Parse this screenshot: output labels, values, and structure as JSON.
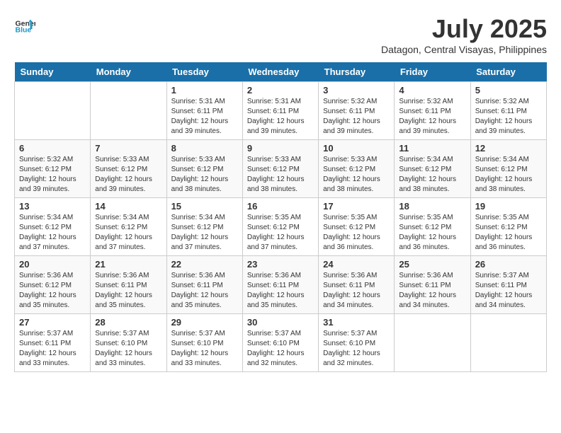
{
  "header": {
    "logo_line1": "General",
    "logo_line2": "Blue",
    "month_title": "July 2025",
    "location": "Datagon, Central Visayas, Philippines"
  },
  "days_of_week": [
    "Sunday",
    "Monday",
    "Tuesday",
    "Wednesday",
    "Thursday",
    "Friday",
    "Saturday"
  ],
  "weeks": [
    [
      {
        "day": "",
        "info": ""
      },
      {
        "day": "",
        "info": ""
      },
      {
        "day": "1",
        "info": "Sunrise: 5:31 AM\nSunset: 6:11 PM\nDaylight: 12 hours and 39 minutes."
      },
      {
        "day": "2",
        "info": "Sunrise: 5:31 AM\nSunset: 6:11 PM\nDaylight: 12 hours and 39 minutes."
      },
      {
        "day": "3",
        "info": "Sunrise: 5:32 AM\nSunset: 6:11 PM\nDaylight: 12 hours and 39 minutes."
      },
      {
        "day": "4",
        "info": "Sunrise: 5:32 AM\nSunset: 6:11 PM\nDaylight: 12 hours and 39 minutes."
      },
      {
        "day": "5",
        "info": "Sunrise: 5:32 AM\nSunset: 6:11 PM\nDaylight: 12 hours and 39 minutes."
      }
    ],
    [
      {
        "day": "6",
        "info": "Sunrise: 5:32 AM\nSunset: 6:12 PM\nDaylight: 12 hours and 39 minutes."
      },
      {
        "day": "7",
        "info": "Sunrise: 5:33 AM\nSunset: 6:12 PM\nDaylight: 12 hours and 39 minutes."
      },
      {
        "day": "8",
        "info": "Sunrise: 5:33 AM\nSunset: 6:12 PM\nDaylight: 12 hours and 38 minutes."
      },
      {
        "day": "9",
        "info": "Sunrise: 5:33 AM\nSunset: 6:12 PM\nDaylight: 12 hours and 38 minutes."
      },
      {
        "day": "10",
        "info": "Sunrise: 5:33 AM\nSunset: 6:12 PM\nDaylight: 12 hours and 38 minutes."
      },
      {
        "day": "11",
        "info": "Sunrise: 5:34 AM\nSunset: 6:12 PM\nDaylight: 12 hours and 38 minutes."
      },
      {
        "day": "12",
        "info": "Sunrise: 5:34 AM\nSunset: 6:12 PM\nDaylight: 12 hours and 38 minutes."
      }
    ],
    [
      {
        "day": "13",
        "info": "Sunrise: 5:34 AM\nSunset: 6:12 PM\nDaylight: 12 hours and 37 minutes."
      },
      {
        "day": "14",
        "info": "Sunrise: 5:34 AM\nSunset: 6:12 PM\nDaylight: 12 hours and 37 minutes."
      },
      {
        "day": "15",
        "info": "Sunrise: 5:34 AM\nSunset: 6:12 PM\nDaylight: 12 hours and 37 minutes."
      },
      {
        "day": "16",
        "info": "Sunrise: 5:35 AM\nSunset: 6:12 PM\nDaylight: 12 hours and 37 minutes."
      },
      {
        "day": "17",
        "info": "Sunrise: 5:35 AM\nSunset: 6:12 PM\nDaylight: 12 hours and 36 minutes."
      },
      {
        "day": "18",
        "info": "Sunrise: 5:35 AM\nSunset: 6:12 PM\nDaylight: 12 hours and 36 minutes."
      },
      {
        "day": "19",
        "info": "Sunrise: 5:35 AM\nSunset: 6:12 PM\nDaylight: 12 hours and 36 minutes."
      }
    ],
    [
      {
        "day": "20",
        "info": "Sunrise: 5:36 AM\nSunset: 6:12 PM\nDaylight: 12 hours and 35 minutes."
      },
      {
        "day": "21",
        "info": "Sunrise: 5:36 AM\nSunset: 6:11 PM\nDaylight: 12 hours and 35 minutes."
      },
      {
        "day": "22",
        "info": "Sunrise: 5:36 AM\nSunset: 6:11 PM\nDaylight: 12 hours and 35 minutes."
      },
      {
        "day": "23",
        "info": "Sunrise: 5:36 AM\nSunset: 6:11 PM\nDaylight: 12 hours and 35 minutes."
      },
      {
        "day": "24",
        "info": "Sunrise: 5:36 AM\nSunset: 6:11 PM\nDaylight: 12 hours and 34 minutes."
      },
      {
        "day": "25",
        "info": "Sunrise: 5:36 AM\nSunset: 6:11 PM\nDaylight: 12 hours and 34 minutes."
      },
      {
        "day": "26",
        "info": "Sunrise: 5:37 AM\nSunset: 6:11 PM\nDaylight: 12 hours and 34 minutes."
      }
    ],
    [
      {
        "day": "27",
        "info": "Sunrise: 5:37 AM\nSunset: 6:11 PM\nDaylight: 12 hours and 33 minutes."
      },
      {
        "day": "28",
        "info": "Sunrise: 5:37 AM\nSunset: 6:10 PM\nDaylight: 12 hours and 33 minutes."
      },
      {
        "day": "29",
        "info": "Sunrise: 5:37 AM\nSunset: 6:10 PM\nDaylight: 12 hours and 33 minutes."
      },
      {
        "day": "30",
        "info": "Sunrise: 5:37 AM\nSunset: 6:10 PM\nDaylight: 12 hours and 32 minutes."
      },
      {
        "day": "31",
        "info": "Sunrise: 5:37 AM\nSunset: 6:10 PM\nDaylight: 12 hours and 32 minutes."
      },
      {
        "day": "",
        "info": ""
      },
      {
        "day": "",
        "info": ""
      }
    ]
  ]
}
